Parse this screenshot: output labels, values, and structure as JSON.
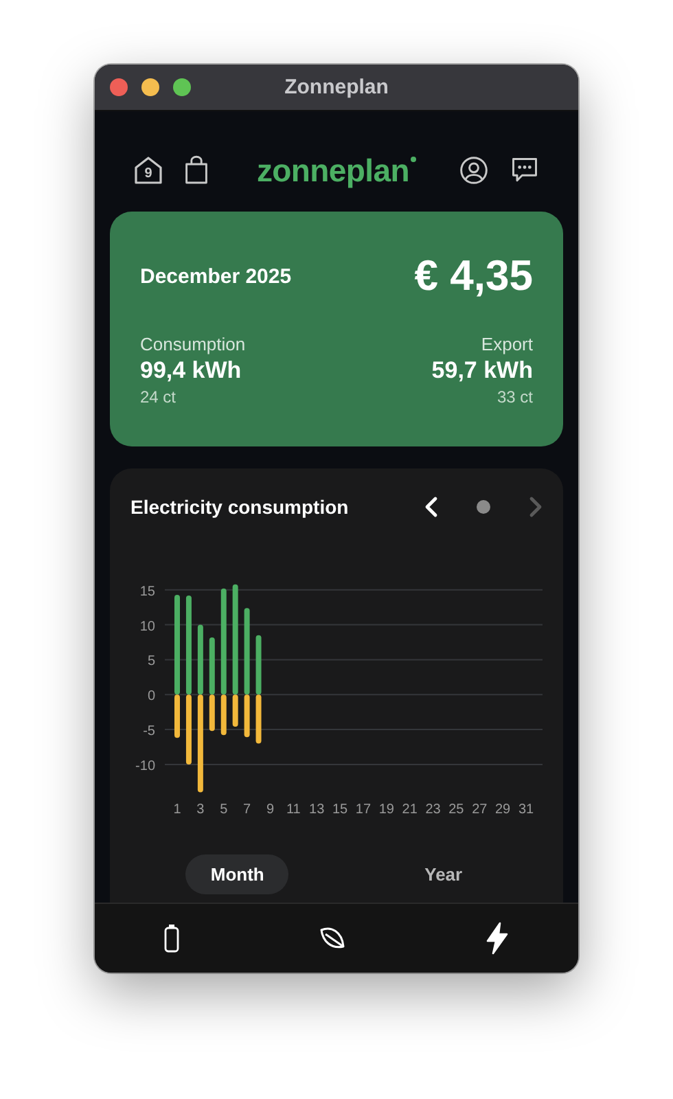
{
  "window": {
    "title": "Zonneplan"
  },
  "header": {
    "home_badge": "9",
    "logo": "zonneplan"
  },
  "summary": {
    "period": "December 2025",
    "total": "€ 4,35",
    "consumption": {
      "label": "Consumption",
      "amount": "99,4 kWh",
      "price": "24 ct"
    },
    "export": {
      "label": "Export",
      "amount": "59,7 kWh",
      "price": "33 ct"
    }
  },
  "chart_card": {
    "title": "Electricity consumption",
    "prev_disabled": false,
    "next_disabled": true,
    "chart_data": {
      "type": "bar",
      "stacked": true,
      "grid": true,
      "x": [
        1,
        2,
        3,
        4,
        5,
        6,
        7,
        8
      ],
      "xlim": [
        1,
        31
      ],
      "ylim": [
        -14,
        16
      ],
      "series": [
        {
          "color": "#4caf63",
          "values": [
            14.3,
            14.2,
            10,
            8.2,
            15.2,
            15.8,
            12.4,
            8.5
          ]
        },
        {
          "color": "#f2b83b",
          "values": [
            -6.2,
            -10,
            -14,
            -5.2,
            -5.8,
            -4.6,
            -6.1,
            -7
          ]
        }
      ],
      "yticks": [
        -10,
        -5,
        0,
        5,
        10,
        15
      ],
      "xticks": [
        1,
        3,
        5,
        7,
        9,
        11,
        13,
        15,
        17,
        19,
        21,
        23,
        25,
        27,
        29,
        31
      ]
    }
  },
  "period_tabs": [
    {
      "label": "Month",
      "selected": true
    },
    {
      "label": "Year",
      "selected": false
    }
  ],
  "bottom_nav": [
    {
      "kind": "battery",
      "selected": false
    },
    {
      "kind": "leaf",
      "selected": false
    },
    {
      "kind": "bolt",
      "selected": true
    }
  ]
}
